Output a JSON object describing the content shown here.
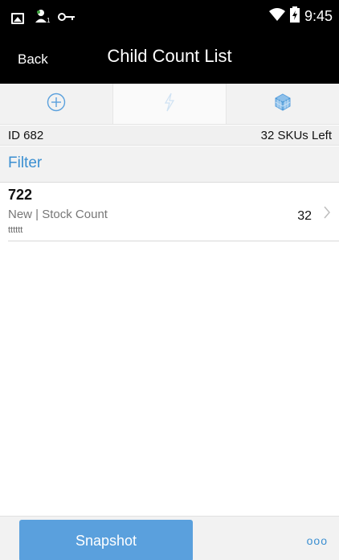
{
  "status_bar": {
    "icons": [
      "image-icon",
      "user-location-icon",
      "key-icon",
      "wifi-icon",
      "battery-icon"
    ],
    "time": "9:45"
  },
  "header": {
    "back_label": "Back",
    "title": "Child Count List"
  },
  "tabs": [
    {
      "icon": "add-circle-icon",
      "active": false
    },
    {
      "icon": "lightning-icon",
      "active": true
    },
    {
      "icon": "cube-icon",
      "active": false
    }
  ],
  "info": {
    "id_label": "ID 682",
    "skus_left": "32 SKUs Left"
  },
  "filter": {
    "label": "Filter"
  },
  "list": {
    "items": [
      {
        "id": "722",
        "subtitle": "New | Stock Count",
        "description": "tttttt",
        "count": "32"
      }
    ]
  },
  "footer": {
    "snapshot_label": "Snapshot",
    "more_label": "ooo"
  },
  "colors": {
    "accent": "#3b8fd1",
    "button": "#5aa0dd",
    "bar": "#000000"
  }
}
